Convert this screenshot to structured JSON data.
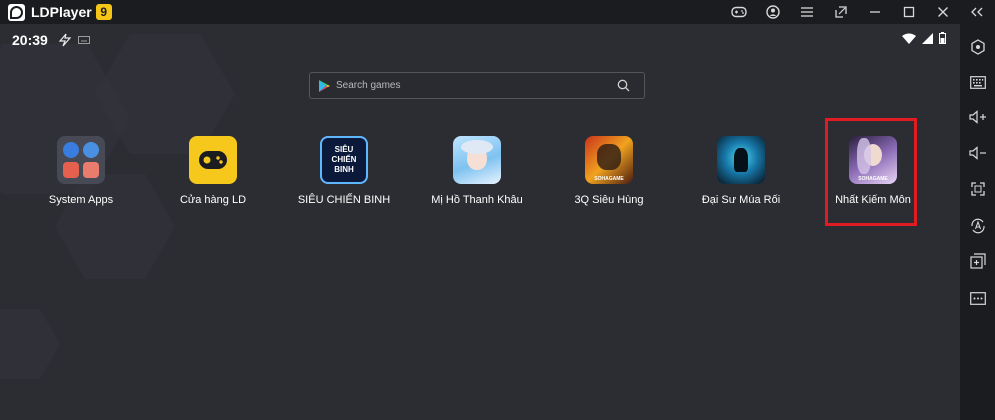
{
  "titlebar": {
    "app_name": "LDPlayer",
    "version_badge": "9",
    "icons": [
      "gamepad-icon",
      "account-icon",
      "menu-icon",
      "restore-icon",
      "minimize-icon",
      "maximize-icon",
      "close-icon",
      "collapse-sidebar-icon"
    ]
  },
  "statusbar": {
    "time": "20:39",
    "icons": [
      "lightning-icon",
      "keyboard-status-icon",
      "wifi-icon",
      "signal-icon",
      "battery-icon"
    ]
  },
  "search": {
    "placeholder": "Search games"
  },
  "apps": [
    {
      "label": "System Apps"
    },
    {
      "label": "Cửa hàng LD"
    },
    {
      "label": "SIÊU CHIẾN BINH",
      "icon_text": [
        "SIÊU",
        "CHIẾN",
        "BINH"
      ]
    },
    {
      "label": "Mị Hồ Thanh Khâu"
    },
    {
      "label": "3Q Siêu Hùng",
      "icon_badge": "SOHAGAME"
    },
    {
      "label": "Đại Sư Múa Rối"
    },
    {
      "label": "Nhất Kiếm Môn",
      "icon_badge": "SOHAGAME"
    }
  ],
  "sidebar": {
    "tools": [
      "settings-hex-icon",
      "keyboard-mapping-icon",
      "volume-up-icon",
      "volume-down-icon",
      "fullscreen-icon",
      "auto-rotate-icon",
      "add-instance-icon",
      "more-icon"
    ]
  },
  "colors": {
    "highlight": "#e01b22",
    "accent": "#f5c518",
    "background": "#2c2d33"
  }
}
